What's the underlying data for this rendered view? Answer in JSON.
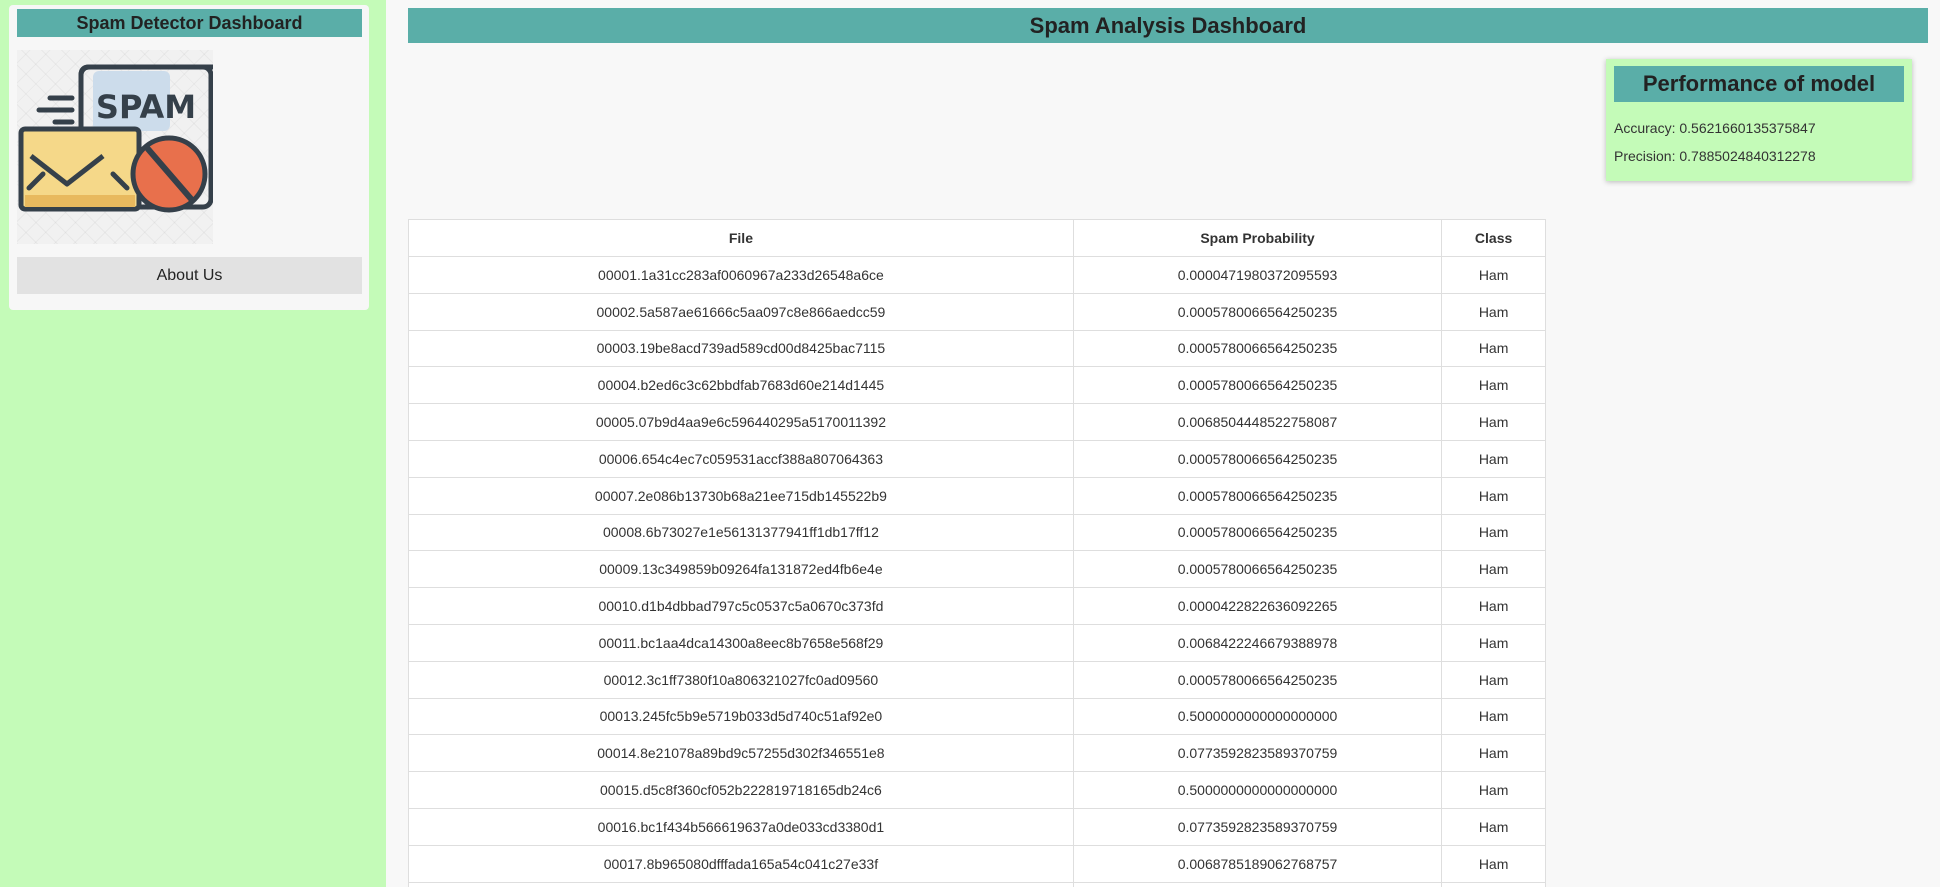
{
  "sidebar": {
    "title": "Spam Detector Dashboard",
    "logo_text": "SPAM",
    "about_label": "About Us"
  },
  "main": {
    "title": "Spam Analysis Dashboard"
  },
  "performance": {
    "title": "Performance of model",
    "accuracy": "Accuracy: 0.5621660135375847",
    "precision": "Precision: 0.7885024840312278"
  },
  "table": {
    "headers": [
      "File",
      "Spam Probability",
      "Class"
    ],
    "rows": [
      [
        "00001.1a31cc283af0060967a233d26548a6ce",
        "0.0000471980372095593",
        "Ham"
      ],
      [
        "00002.5a587ae61666c5aa097c8e866aedcc59",
        "0.0005780066564250235",
        "Ham"
      ],
      [
        "00003.19be8acd739ad589cd00d8425bac7115",
        "0.0005780066564250235",
        "Ham"
      ],
      [
        "00004.b2ed6c3c62bbdfab7683d60e214d1445",
        "0.0005780066564250235",
        "Ham"
      ],
      [
        "00005.07b9d4aa9e6c596440295a5170011392",
        "0.0068504448522758087",
        "Ham"
      ],
      [
        "00006.654c4ec7c059531accf388a807064363",
        "0.0005780066564250235",
        "Ham"
      ],
      [
        "00007.2e086b13730b68a21ee715db145522b9",
        "0.0005780066564250235",
        "Ham"
      ],
      [
        "00008.6b73027e1e56131377941ff1db17ff12",
        "0.0005780066564250235",
        "Ham"
      ],
      [
        "00009.13c349859b09264fa131872ed4fb6e4e",
        "0.0005780066564250235",
        "Ham"
      ],
      [
        "00010.d1b4dbbad797c5c0537c5a0670c373fd",
        "0.0000422822636092265",
        "Ham"
      ],
      [
        "00011.bc1aa4dca14300a8eec8b7658e568f29",
        "0.0068422246679388978",
        "Ham"
      ],
      [
        "00012.3c1ff7380f10a806321027fc0ad09560",
        "0.0005780066564250235",
        "Ham"
      ],
      [
        "00013.245fc5b9e5719b033d5d740c51af92e0",
        "0.5000000000000000000",
        "Ham"
      ],
      [
        "00014.8e21078a89bd9c57255d302f346551e8",
        "0.0773592823589370759",
        "Ham"
      ],
      [
        "00015.d5c8f360cf052b222819718165db24c6",
        "0.5000000000000000000",
        "Ham"
      ],
      [
        "00016.bc1f434b566619637a0de033cd3380d1",
        "0.0773592823589370759",
        "Ham"
      ],
      [
        "00017.8b965080dfffada165a54c041c27e33f",
        "0.0068785189062768757",
        "Ham"
      ],
      [
        "",
        "",
        ""
      ]
    ]
  }
}
